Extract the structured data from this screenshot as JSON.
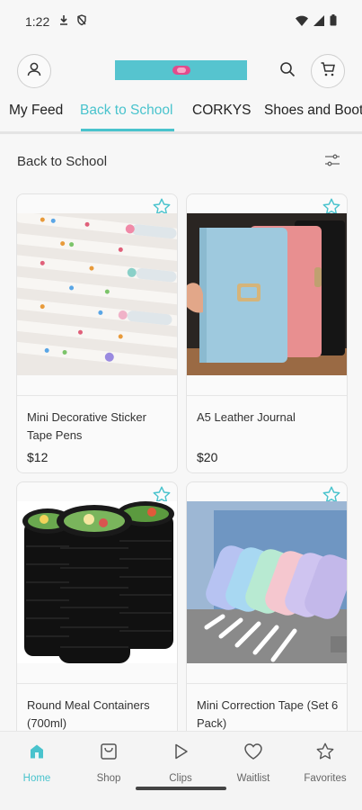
{
  "status_bar": {
    "time": "1:22"
  },
  "header": {
    "logo_alt": "app-logo"
  },
  "tabs": [
    {
      "label": "My Feed",
      "active": false
    },
    {
      "label": "Back to School",
      "active": true
    },
    {
      "label": "CORKYS",
      "active": false
    },
    {
      "label": "Shoes and Boots",
      "active": false
    }
  ],
  "section": {
    "title": "Back to School"
  },
  "products": [
    {
      "name": "Mini Decorative Sticker Tape Pens",
      "price": "$12",
      "image": "sticker-tape-pens-photo"
    },
    {
      "name": "A5 Leather Journal",
      "price": "$20",
      "image": "leather-journals-photo"
    },
    {
      "name": "Round Meal Containers (700ml)",
      "price": "",
      "image": "meal-containers-photo"
    },
    {
      "name": "Mini Correction Tape (Set 6 Pack)",
      "price": "",
      "image": "correction-tape-photo"
    }
  ],
  "bottom_nav": [
    {
      "label": "Home",
      "icon": "home-icon",
      "active": true
    },
    {
      "label": "Shop",
      "icon": "shop-icon",
      "active": false
    },
    {
      "label": "Clips",
      "icon": "play-icon",
      "active": false
    },
    {
      "label": "Waitlist",
      "icon": "heart-icon",
      "active": false
    },
    {
      "label": "Favorites",
      "icon": "star-icon",
      "active": false
    }
  ],
  "colors": {
    "accent": "#49c3cd",
    "logo_bg": "#56c4cf"
  }
}
